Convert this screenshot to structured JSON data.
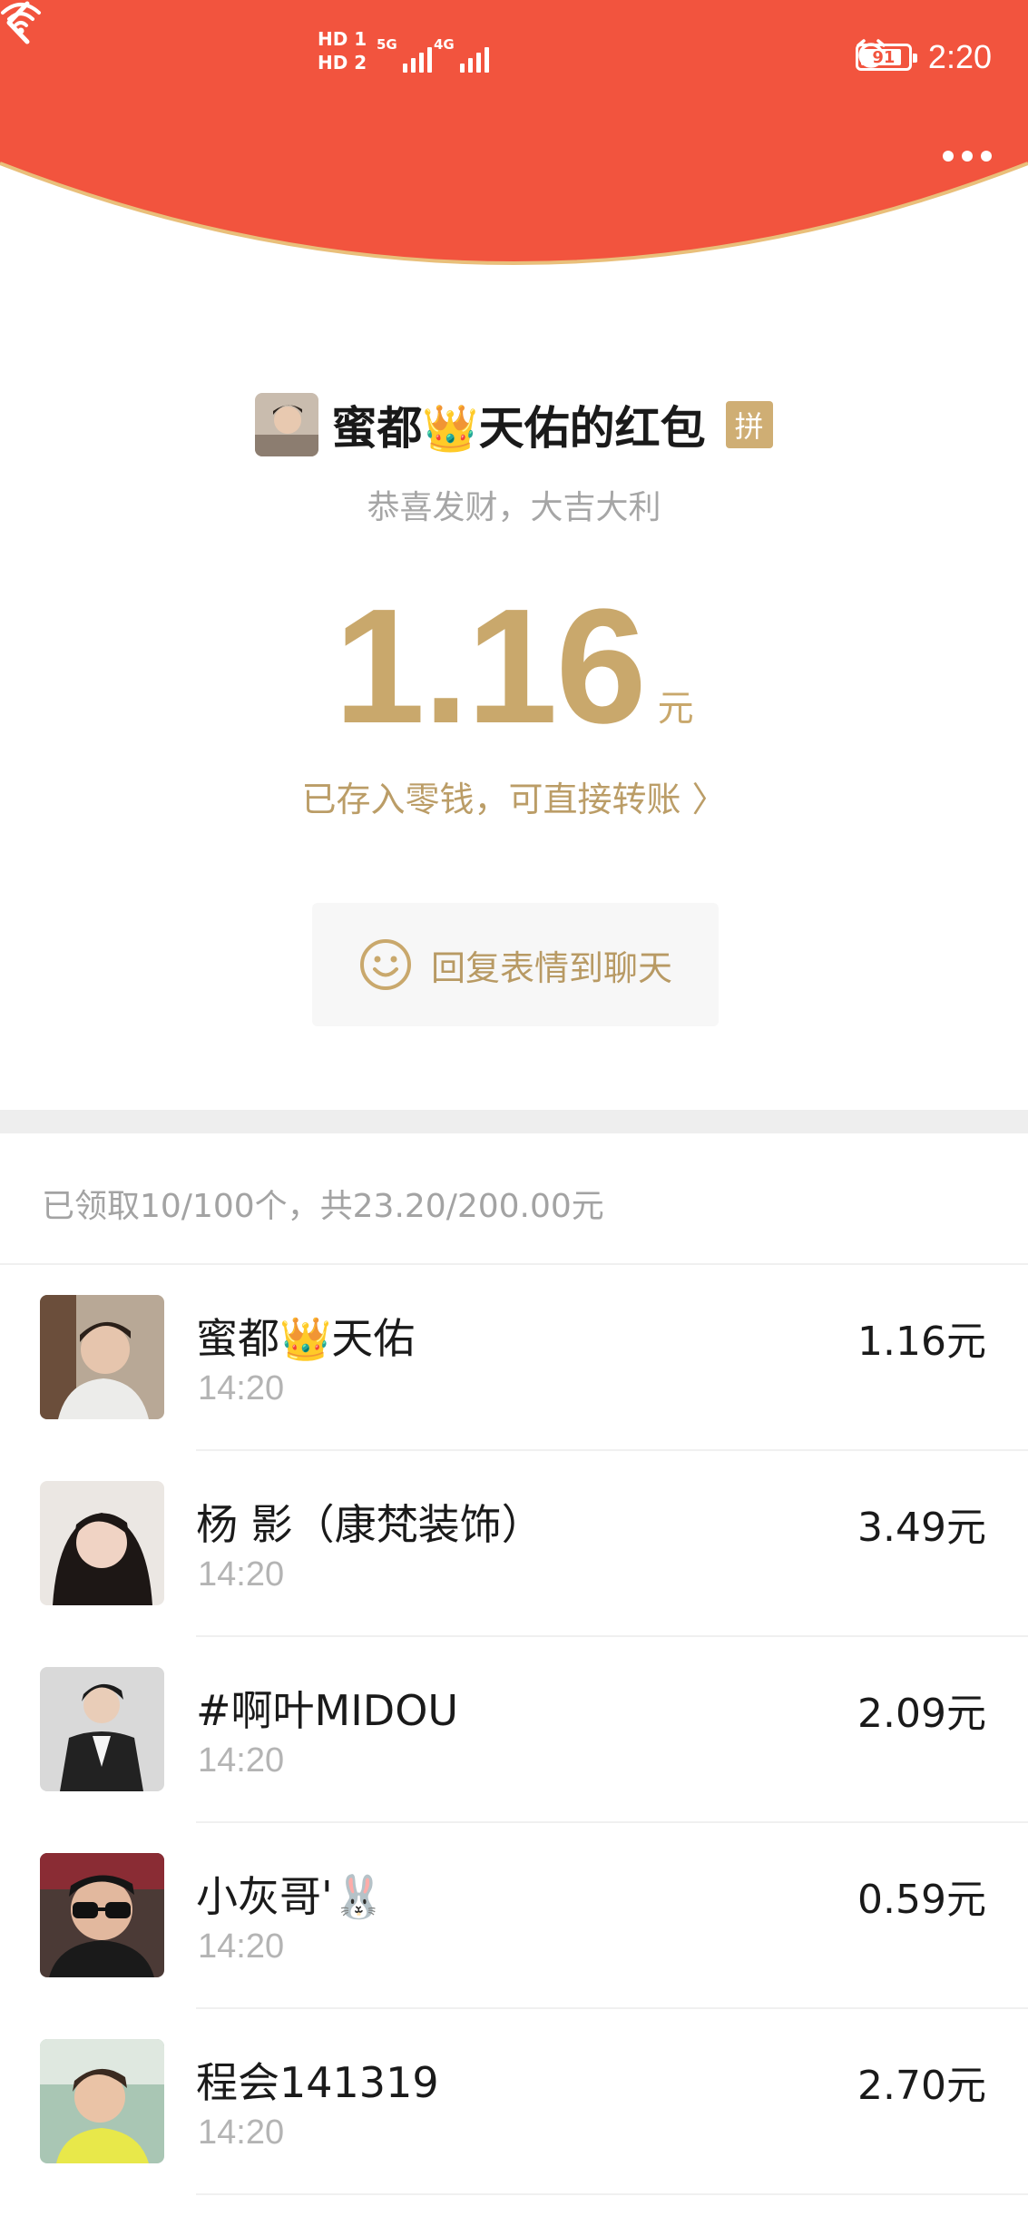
{
  "colors": {
    "header_red": "#f2543e",
    "gold": "#c9a86c",
    "header_edge": "#e9bf7a"
  },
  "status_bar": {
    "hd1": "HD 1",
    "hd2": "HD 2",
    "sig1": "5G",
    "sig2": "4G",
    "battery": "91",
    "time": "2:20"
  },
  "nav": {
    "back_icon": "chevron-left",
    "more_icon": "more-horizontal"
  },
  "packet": {
    "sender_title": "蜜都👑天佑的红包",
    "badge": "拼",
    "wish": "恭喜发财，大吉大利",
    "amount": "1.16",
    "unit": "元",
    "balance_link": "已存入零钱，可直接转账 〉",
    "reply_button": "回复表情到聊天"
  },
  "summary": "已领取10/100个，共23.20/200.00元",
  "claims": [
    {
      "name": "蜜都👑天佑",
      "time": "14:20",
      "amount": "1.16元"
    },
    {
      "name": "杨 影（康梵装饰）",
      "time": "14:20",
      "amount": "3.49元"
    },
    {
      "name": "#啊叶MIDOU",
      "time": "14:20",
      "amount": "2.09元"
    },
    {
      "name": "小灰哥'🐰",
      "time": "14:20",
      "amount": "0.59元"
    },
    {
      "name": "程会141319",
      "time": "14:20",
      "amount": "2.70元"
    }
  ]
}
